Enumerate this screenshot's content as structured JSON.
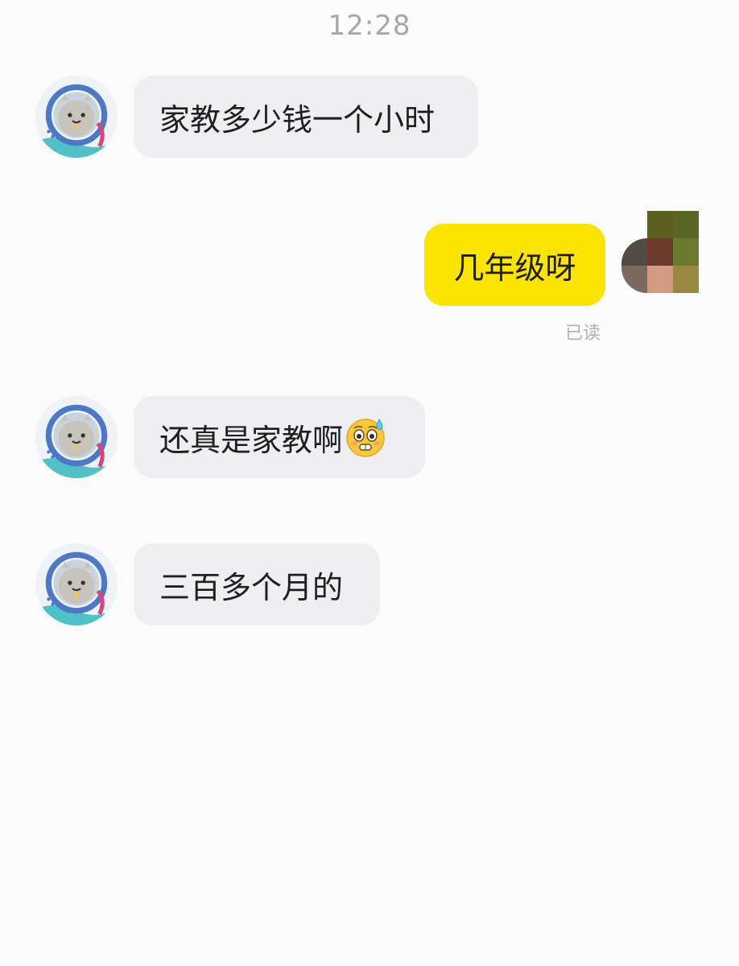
{
  "header": {
    "time": "12:28"
  },
  "messages": [
    {
      "side": "incoming",
      "text": "家教多少钱一个小时"
    },
    {
      "side": "outgoing",
      "text": "几年级呀",
      "status": "已读"
    },
    {
      "side": "incoming",
      "text": "还真是家教啊",
      "emoji": "flushed-sweat-emoji"
    },
    {
      "side": "incoming",
      "text": "三百多个月的"
    }
  ],
  "colors": {
    "background": "#fbfbfb",
    "incoming_bubble": "#efeff2",
    "outgoing_bubble": "#fbe400",
    "timestamp": "#a7a7a7",
    "read_status": "#b0b0b0"
  },
  "icons": {
    "incoming_avatar": "cartoon-seal-avatar-icon",
    "outgoing_avatar": "pixelated-photo-avatar"
  }
}
